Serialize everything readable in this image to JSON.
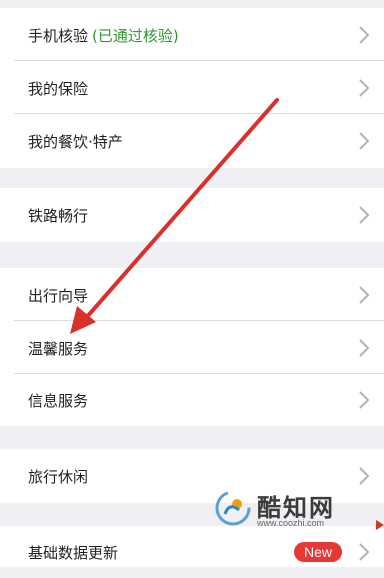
{
  "group1": [
    {
      "label": "手机核验",
      "status": "(已通过核验)"
    },
    {
      "label": "我的保险"
    },
    {
      "label": "我的餐饮·特产"
    }
  ],
  "group2": [
    {
      "label": "铁路畅行"
    }
  ],
  "group3": [
    {
      "label": "出行向导"
    },
    {
      "label": "温馨服务"
    },
    {
      "label": "信息服务"
    }
  ],
  "group4": [
    {
      "label": "旅行休闲"
    }
  ],
  "group5": [
    {
      "label": "基础数据更新",
      "badge": "New"
    }
  ],
  "watermark": {
    "title": "酷知网",
    "url": "www.coozhi.com"
  },
  "colors": {
    "status_green": "#2f9a2f",
    "badge_red": "#e53935",
    "annotation_arrow": "#d9302b"
  },
  "icons": [
    "chevron-right-icon",
    "coozhi-logo-icon"
  ]
}
